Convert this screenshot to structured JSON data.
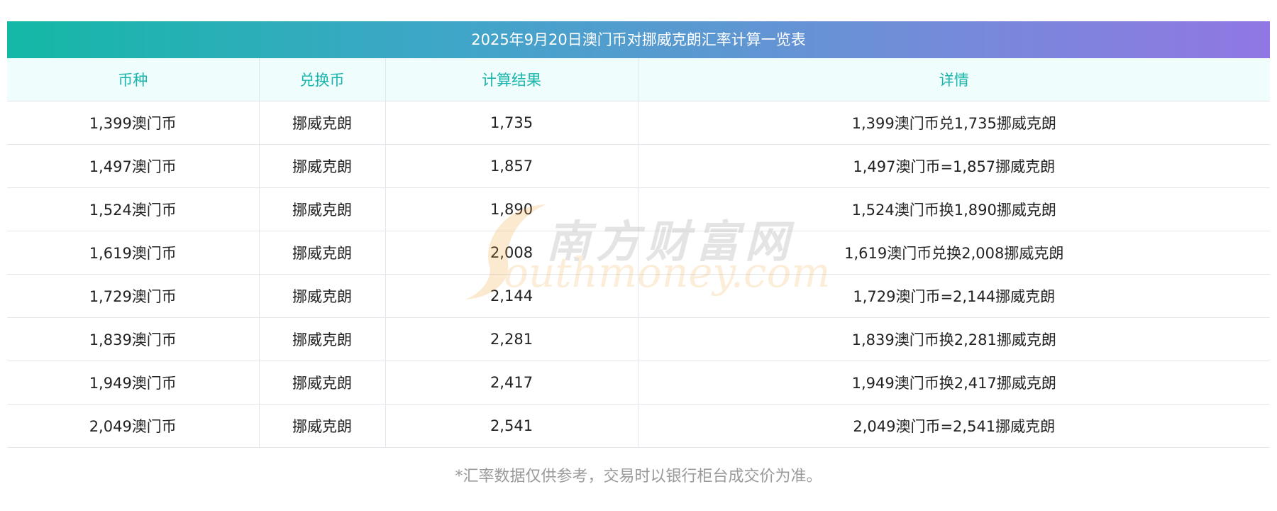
{
  "title": "2025年9月20日澳门币对挪威克朗汇率计算一览表",
  "headers": [
    "币种",
    "兑换币",
    "计算结果",
    "详情"
  ],
  "rows": [
    [
      "1,399澳门币",
      "挪威克朗",
      "1,735",
      "1,399澳门币兑1,735挪威克朗"
    ],
    [
      "1,497澳门币",
      "挪威克朗",
      "1,857",
      "1,497澳门币=1,857挪威克朗"
    ],
    [
      "1,524澳门币",
      "挪威克朗",
      "1,890",
      "1,524澳门币换1,890挪威克朗"
    ],
    [
      "1,619澳门币",
      "挪威克朗",
      "2,008",
      "1,619澳门币兑换2,008挪威克朗"
    ],
    [
      "1,729澳门币",
      "挪威克朗",
      "2,144",
      "1,729澳门币=2,144挪威克朗"
    ],
    [
      "1,839澳门币",
      "挪威克朗",
      "2,281",
      "1,839澳门币换2,281挪威克朗"
    ],
    [
      "1,949澳门币",
      "挪威克朗",
      "2,417",
      "1,949澳门币换2,417挪威克朗"
    ],
    [
      "2,049澳门币",
      "挪威克朗",
      "2,541",
      "2,049澳门币=2,541挪威克朗"
    ]
  ],
  "footnote": "*汇率数据仅供参考，交易时以银行柜台成交价为准。",
  "watermark": {
    "cn": "南方财富网",
    "en": "outhmoney.com"
  },
  "colors": {
    "header_text": "#19b5ad",
    "header_bg": "#effdfd",
    "title_gradient_start": "#14b8a6",
    "title_gradient_end": "#9177e3"
  }
}
